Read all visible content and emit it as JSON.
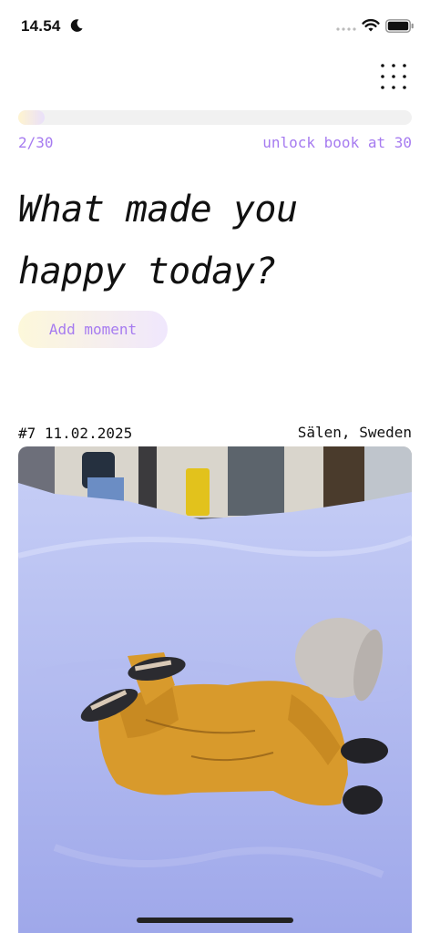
{
  "status_bar": {
    "time": "14.54",
    "focus_icon": "moon-icon",
    "wifi_icon": "wifi-icon",
    "battery_icon": "battery-icon"
  },
  "header": {
    "menu_icon": "grid-dots-icon"
  },
  "progress": {
    "count_label": "2/30",
    "current": 2,
    "total": 30,
    "hint": "unlock book at 30",
    "fill_colors": [
      "#fff4cf",
      "#e9e0fb"
    ]
  },
  "prompt": {
    "heading": "What made you happy today?"
  },
  "actions": {
    "add_moment_label": "Add moment"
  },
  "moment": {
    "meta": "#7 11.02.2025",
    "location": "Sälen, Sweden",
    "photo": "child-in-snow-photo"
  },
  "colors": {
    "accent": "#a67bf0",
    "text": "#111111",
    "background": "#ffffff"
  }
}
